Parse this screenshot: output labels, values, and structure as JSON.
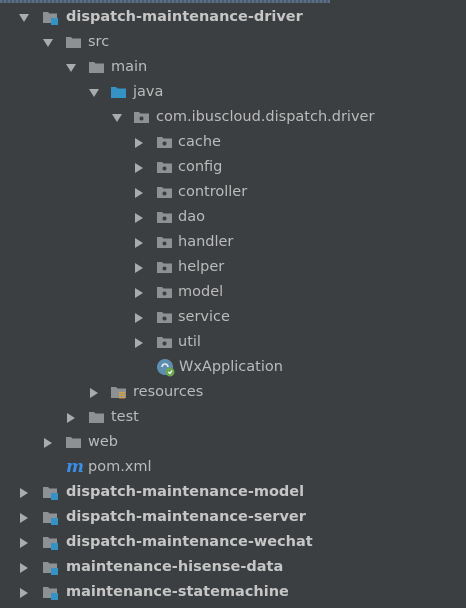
{
  "project_tree": {
    "root": {
      "label": "dispatch-maintenance-driver",
      "expanded": true,
      "icon": "module-folder-icon"
    },
    "items": [
      {
        "label": "src",
        "icon": "folder-icon",
        "expanded": true
      },
      {
        "label": "main",
        "icon": "folder-icon",
        "expanded": true
      },
      {
        "label": "java",
        "icon": "source-root-folder-icon",
        "expanded": true
      },
      {
        "label": "com.ibuscloud.dispatch.driver",
        "icon": "package-icon",
        "expanded": true
      },
      {
        "label": "cache",
        "icon": "package-icon",
        "expanded": false
      },
      {
        "label": "config",
        "icon": "package-icon",
        "expanded": false
      },
      {
        "label": "controller",
        "icon": "package-icon",
        "expanded": false
      },
      {
        "label": "dao",
        "icon": "package-icon",
        "expanded": false
      },
      {
        "label": "handler",
        "icon": "package-icon",
        "expanded": false
      },
      {
        "label": "helper",
        "icon": "package-icon",
        "expanded": false
      },
      {
        "label": "model",
        "icon": "package-icon",
        "expanded": false
      },
      {
        "label": "service",
        "icon": "package-icon",
        "expanded": false
      },
      {
        "label": "util",
        "icon": "package-icon",
        "expanded": false
      },
      {
        "label": "WxApplication",
        "icon": "spring-boot-class-icon"
      },
      {
        "label": "resources",
        "icon": "resources-folder-icon",
        "expanded": false
      },
      {
        "label": "test",
        "icon": "folder-icon",
        "expanded": false
      },
      {
        "label": "web",
        "icon": "folder-icon",
        "expanded": false
      },
      {
        "label": "pom.xml",
        "icon": "maven-icon"
      }
    ],
    "modules": [
      {
        "label": "dispatch-maintenance-model",
        "icon": "module-folder-icon",
        "expanded": false
      },
      {
        "label": "dispatch-maintenance-server",
        "icon": "module-folder-icon",
        "expanded": false
      },
      {
        "label": "dispatch-maintenance-wechat",
        "icon": "module-folder-icon",
        "expanded": false
      },
      {
        "label": "maintenance-hisense-data",
        "icon": "module-folder-icon",
        "expanded": false
      },
      {
        "label": "maintenance-statemachine",
        "icon": "module-folder-icon",
        "expanded": false
      }
    ]
  },
  "maven_icon_glyph": "m",
  "colors": {
    "background": "#3c3f41",
    "text": "#bbbbbb",
    "folder": "#8e9194",
    "source_root": "#3592c4",
    "module_badge": "#3592c4",
    "maven": "#3a8ee6"
  }
}
